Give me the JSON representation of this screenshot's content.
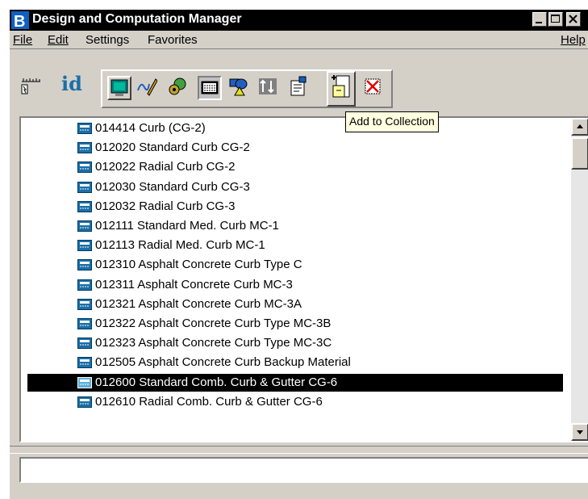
{
  "window": {
    "title": "Design and Computation Manager"
  },
  "menu": {
    "file": "File",
    "edit": "Edit",
    "settings": "Settings",
    "favorites": "Favorites",
    "help": "Help"
  },
  "toolbar": {
    "id_label": "id",
    "tooltip": "Add to Collection"
  },
  "list": {
    "items": [
      "014414 Curb (CG-2)",
      "012020 Standard Curb CG-2",
      "012022 Radial Curb CG-2",
      "012030 Standard Curb CG-3",
      "012032 Radial Curb CG-3",
      "012111 Standard Med. Curb MC-1",
      "012113 Radial Med. Curb MC-1",
      "012310 Asphalt Concrete Curb Type C",
      "012311 Asphalt Concrete Curb MC-3",
      "012321 Asphalt Concrete Curb MC-3A",
      "012322 Asphalt Concrete Curb Type MC-3B",
      "012323 Asphalt Concrete Curb Type MC-3C",
      "012505 Asphalt Concrete Curb Backup Material",
      "012600 Standard Comb. Curb & Gutter CG-6",
      "012610 Radial Comb. Curb & Gutter CG-6"
    ],
    "selected_index": 13
  },
  "colors": {
    "titlebar": "#000000",
    "face": "#d4d0c8",
    "tooltip": "#ffffe1",
    "item_icon": "#1a6fa8"
  }
}
